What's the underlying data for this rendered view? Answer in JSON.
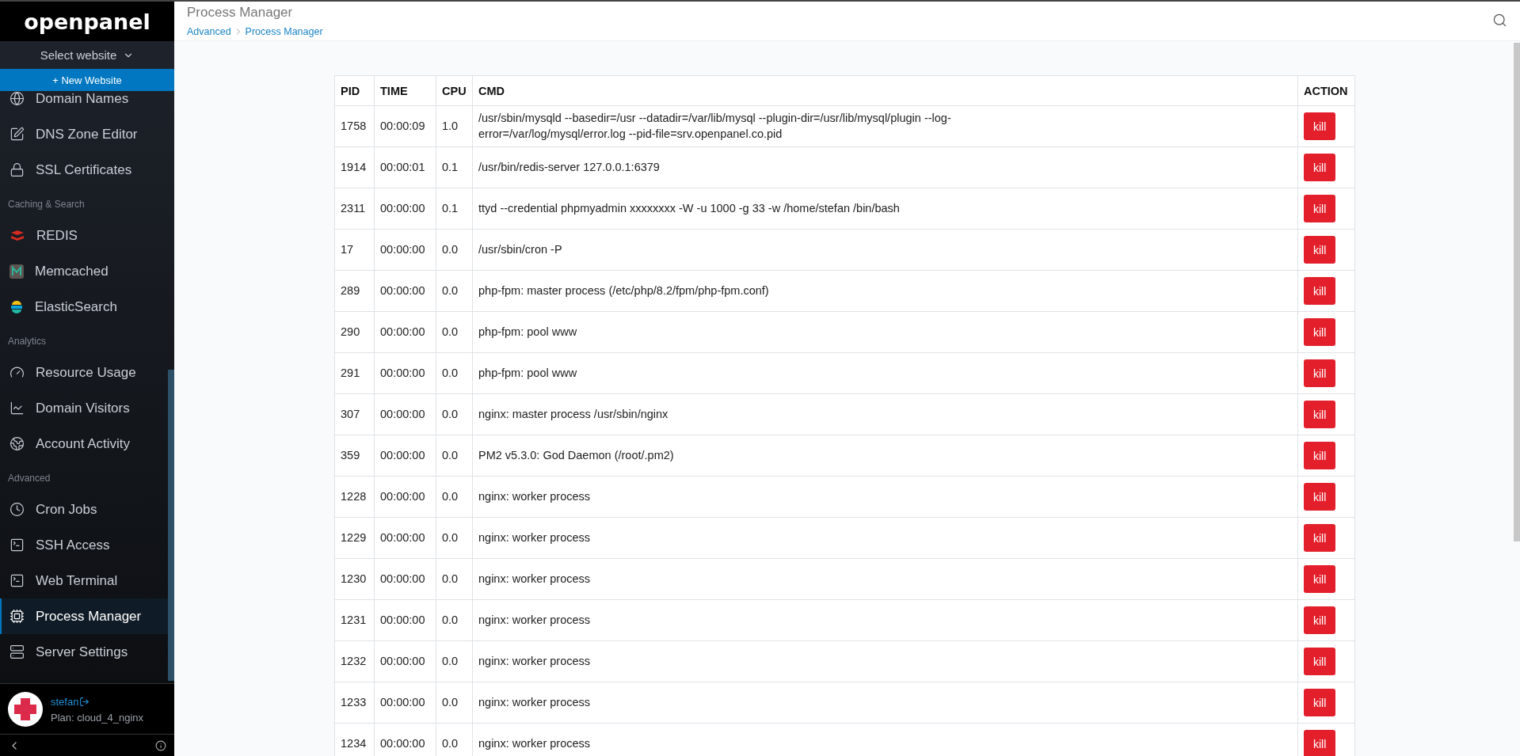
{
  "sidebar": {
    "logo": "openpanel",
    "website_select": "Select website",
    "new_website_button": "+ New Website",
    "sections": [
      {
        "items": [
          {
            "label": "Domain Names",
            "selected": false
          },
          {
            "label": "DNS Zone Editor",
            "selected": false
          },
          {
            "label": "SSL Certificates",
            "selected": false
          }
        ]
      },
      {
        "title": "Caching & Search",
        "items": [
          {
            "label": "REDIS",
            "selected": false
          },
          {
            "label": "Memcached",
            "selected": false
          },
          {
            "label": "ElasticSearch",
            "selected": false
          }
        ]
      },
      {
        "title": "Analytics",
        "items": [
          {
            "label": "Resource Usage",
            "selected": false
          },
          {
            "label": "Domain Visitors",
            "selected": false
          },
          {
            "label": "Account Activity",
            "selected": false
          }
        ]
      },
      {
        "title": "Advanced",
        "items": [
          {
            "label": "Cron Jobs",
            "selected": false
          },
          {
            "label": "SSH Access",
            "selected": false
          },
          {
            "label": "Web Terminal",
            "selected": false
          },
          {
            "label": "Process Manager",
            "selected": true
          },
          {
            "label": "Server Settings",
            "selected": false
          }
        ]
      }
    ],
    "user": {
      "name": "stefan",
      "plan": "Plan: cloud_4_nginx"
    }
  },
  "header": {
    "title": "Process Manager",
    "breadcrumb": [
      "Advanced",
      "Process Manager"
    ]
  },
  "table": {
    "columns": [
      "PID",
      "TIME",
      "CPU",
      "CMD",
      "ACTION"
    ],
    "rows": [
      {
        "pid": "1758",
        "time": "00:00:09",
        "cpu": "1.0",
        "cmd": "/usr/sbin/mysqld --basedir=/usr --datadir=/var/lib/mysql --plugin-dir=/usr/lib/mysql/plugin --log-error=/var/log/mysql/error.log --pid-file=srv.openpanel.co.pid",
        "action": "kill"
      },
      {
        "pid": "1914",
        "time": "00:00:01",
        "cpu": "0.1",
        "cmd": "/usr/bin/redis-server 127.0.0.1:6379",
        "action": "kill"
      },
      {
        "pid": "2311",
        "time": "00:00:00",
        "cpu": "0.1",
        "cmd": "ttyd --credential phpmyadmin xxxxxxxx -W -u 1000 -g 33 -w /home/stefan /bin/bash",
        "action": "kill"
      },
      {
        "pid": "17",
        "time": "00:00:00",
        "cpu": "0.0",
        "cmd": "/usr/sbin/cron -P",
        "action": "kill"
      },
      {
        "pid": "289",
        "time": "00:00:00",
        "cpu": "0.0",
        "cmd": "php-fpm: master process (/etc/php/8.2/fpm/php-fpm.conf)",
        "action": "kill"
      },
      {
        "pid": "290",
        "time": "00:00:00",
        "cpu": "0.0",
        "cmd": "php-fpm: pool www",
        "action": "kill"
      },
      {
        "pid": "291",
        "time": "00:00:00",
        "cpu": "0.0",
        "cmd": "php-fpm: pool www",
        "action": "kill"
      },
      {
        "pid": "307",
        "time": "00:00:00",
        "cpu": "0.0",
        "cmd": "nginx: master process /usr/sbin/nginx",
        "action": "kill"
      },
      {
        "pid": "359",
        "time": "00:00:00",
        "cpu": "0.0",
        "cmd": "PM2 v5.3.0: God Daemon (/root/.pm2)",
        "action": "kill"
      },
      {
        "pid": "1228",
        "time": "00:00:00",
        "cpu": "0.0",
        "cmd": "nginx: worker process",
        "action": "kill"
      },
      {
        "pid": "1229",
        "time": "00:00:00",
        "cpu": "0.0",
        "cmd": "nginx: worker process",
        "action": "kill"
      },
      {
        "pid": "1230",
        "time": "00:00:00",
        "cpu": "0.0",
        "cmd": "nginx: worker process",
        "action": "kill"
      },
      {
        "pid": "1231",
        "time": "00:00:00",
        "cpu": "0.0",
        "cmd": "nginx: worker process",
        "action": "kill"
      },
      {
        "pid": "1232",
        "time": "00:00:00",
        "cpu": "0.0",
        "cmd": "nginx: worker process",
        "action": "kill"
      },
      {
        "pid": "1233",
        "time": "00:00:00",
        "cpu": "0.0",
        "cmd": "nginx: worker process",
        "action": "kill"
      },
      {
        "pid": "1234",
        "time": "00:00:00",
        "cpu": "0.0",
        "cmd": "nginx: worker process",
        "action": "kill"
      }
    ]
  }
}
